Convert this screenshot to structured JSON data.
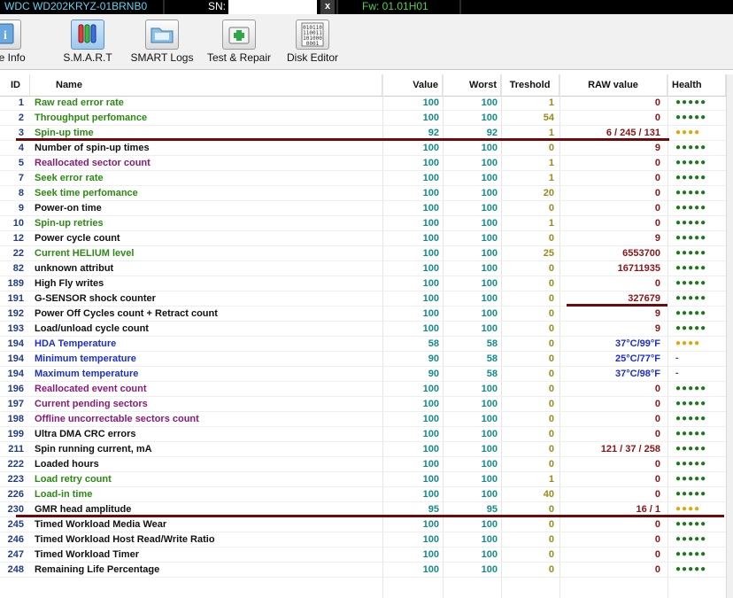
{
  "topbar": {
    "model": "WDC WD202KRYZ-01BRNB0",
    "sn_label": "SN:",
    "sn_value": "",
    "clear_label": "x",
    "firmware": "Fw: 01.01H01"
  },
  "toolbar": {
    "items": [
      {
        "label": "rive Info",
        "icon": "info-icon"
      },
      {
        "label": "S.M.A.R.T",
        "icon": "test-tubes-icon"
      },
      {
        "label": "SMART Logs",
        "icon": "folder-icon"
      },
      {
        "label": "Test & Repair",
        "icon": "first-aid-kit-icon"
      },
      {
        "label": "Disk Editor",
        "icon": "binary-data-icon"
      }
    ]
  },
  "table": {
    "headers": {
      "id": "ID",
      "name": "Name",
      "value": "Value",
      "worst": "Worst",
      "threshold": "Treshold",
      "raw": "RAW value",
      "health": "Health"
    },
    "rows": [
      {
        "id": "1",
        "name": "Raw read error rate",
        "value": "100",
        "worst": "100",
        "threshold": "1",
        "raw": "0",
        "health": "●●●●●",
        "name_color": "green",
        "health_color": "green"
      },
      {
        "id": "2",
        "name": "Throughput perfomance",
        "value": "100",
        "worst": "100",
        "threshold": "54",
        "raw": "0",
        "health": "●●●●●",
        "name_color": "green",
        "health_color": "green"
      },
      {
        "id": "3",
        "name": "Spin-up time",
        "value": "92",
        "worst": "92",
        "threshold": "1",
        "raw": "6 / 245 / 131",
        "health": "●●●●",
        "name_color": "green",
        "health_color": "yellow"
      },
      {
        "id": "4",
        "name": "Number of spin-up times",
        "value": "100",
        "worst": "100",
        "threshold": "0",
        "raw": "9",
        "health": "●●●●●",
        "name_color": "black",
        "health_color": "green"
      },
      {
        "id": "5",
        "name": "Reallocated sector count",
        "value": "100",
        "worst": "100",
        "threshold": "1",
        "raw": "0",
        "health": "●●●●●",
        "name_color": "purple",
        "health_color": "green"
      },
      {
        "id": "7",
        "name": "Seek error rate",
        "value": "100",
        "worst": "100",
        "threshold": "1",
        "raw": "0",
        "health": "●●●●●",
        "name_color": "green",
        "health_color": "green"
      },
      {
        "id": "8",
        "name": "Seek time perfomance",
        "value": "100",
        "worst": "100",
        "threshold": "20",
        "raw": "0",
        "health": "●●●●●",
        "name_color": "green",
        "health_color": "green"
      },
      {
        "id": "9",
        "name": "Power-on time",
        "value": "100",
        "worst": "100",
        "threshold": "0",
        "raw": "0",
        "health": "●●●●●",
        "name_color": "black",
        "health_color": "green"
      },
      {
        "id": "10",
        "name": "Spin-up retries",
        "value": "100",
        "worst": "100",
        "threshold": "1",
        "raw": "0",
        "health": "●●●●●",
        "name_color": "green",
        "health_color": "green"
      },
      {
        "id": "12",
        "name": "Power cycle count",
        "value": "100",
        "worst": "100",
        "threshold": "0",
        "raw": "9",
        "health": "●●●●●",
        "name_color": "black",
        "health_color": "green"
      },
      {
        "id": "22",
        "name": "Current HELIUM level",
        "value": "100",
        "worst": "100",
        "threshold": "25",
        "raw": "6553700",
        "health": "●●●●●",
        "name_color": "green",
        "health_color": "green"
      },
      {
        "id": "82",
        "name": "unknown attribut",
        "value": "100",
        "worst": "100",
        "threshold": "0",
        "raw": "16711935",
        "health": "●●●●●",
        "name_color": "black",
        "health_color": "green"
      },
      {
        "id": "189",
        "name": "High Fly writes",
        "value": "100",
        "worst": "100",
        "threshold": "0",
        "raw": "0",
        "health": "●●●●●",
        "name_color": "black",
        "health_color": "green"
      },
      {
        "id": "191",
        "name": "G-SENSOR shock counter",
        "value": "100",
        "worst": "100",
        "threshold": "0",
        "raw": "327679",
        "health": "●●●●●",
        "name_color": "black",
        "health_color": "green"
      },
      {
        "id": "192",
        "name": "Power Off Cycles count + Retract count",
        "value": "100",
        "worst": "100",
        "threshold": "0",
        "raw": "9",
        "health": "●●●●●",
        "name_color": "black",
        "health_color": "green"
      },
      {
        "id": "193",
        "name": "Load/unload cycle count",
        "value": "100",
        "worst": "100",
        "threshold": "0",
        "raw": "9",
        "health": "●●●●●",
        "name_color": "black",
        "health_color": "green"
      },
      {
        "id": "194",
        "name": "HDA Temperature",
        "value": "58",
        "worst": "58",
        "threshold": "0",
        "raw": "37°C/99°F",
        "health": "●●●●",
        "name_color": "blue",
        "health_color": "yellow",
        "raw_color": "blue"
      },
      {
        "id": "194",
        "name": "Minimum temperature",
        "value": "90",
        "worst": "58",
        "threshold": "0",
        "raw": "25°C/77°F",
        "health": "-",
        "name_color": "blue",
        "health_color": "blue",
        "raw_color": "blue"
      },
      {
        "id": "194",
        "name": "Maximum temperature",
        "value": "90",
        "worst": "58",
        "threshold": "0",
        "raw": "37°C/98°F",
        "health": "-",
        "name_color": "blue",
        "health_color": "blue",
        "raw_color": "blue"
      },
      {
        "id": "196",
        "name": "Reallocated event count",
        "value": "100",
        "worst": "100",
        "threshold": "0",
        "raw": "0",
        "health": "●●●●●",
        "name_color": "purple",
        "health_color": "green"
      },
      {
        "id": "197",
        "name": "Current pending sectors",
        "value": "100",
        "worst": "100",
        "threshold": "0",
        "raw": "0",
        "health": "●●●●●",
        "name_color": "purple",
        "health_color": "green"
      },
      {
        "id": "198",
        "name": "Offline uncorrectable sectors count",
        "value": "100",
        "worst": "100",
        "threshold": "0",
        "raw": "0",
        "health": "●●●●●",
        "name_color": "purple",
        "health_color": "green"
      },
      {
        "id": "199",
        "name": "Ultra DMA CRC errors",
        "value": "100",
        "worst": "100",
        "threshold": "0",
        "raw": "0",
        "health": "●●●●●",
        "name_color": "black",
        "health_color": "green"
      },
      {
        "id": "211",
        "name": "Spin running current, mA",
        "value": "100",
        "worst": "100",
        "threshold": "0",
        "raw": "121 / 37 / 258",
        "health": "●●●●●",
        "name_color": "black",
        "health_color": "green"
      },
      {
        "id": "222",
        "name": "Loaded hours",
        "value": "100",
        "worst": "100",
        "threshold": "0",
        "raw": "0",
        "health": "●●●●●",
        "name_color": "black",
        "health_color": "green"
      },
      {
        "id": "223",
        "name": "Load retry count",
        "value": "100",
        "worst": "100",
        "threshold": "1",
        "raw": "0",
        "health": "●●●●●",
        "name_color": "green",
        "health_color": "green"
      },
      {
        "id": "226",
        "name": "Load-in time",
        "value": "100",
        "worst": "100",
        "threshold": "40",
        "raw": "0",
        "health": "●●●●●",
        "name_color": "green",
        "health_color": "green"
      },
      {
        "id": "230",
        "name": "GMR head amplitude",
        "value": "95",
        "worst": "95",
        "threshold": "0",
        "raw": "16 / 1",
        "health": "●●●●",
        "name_color": "black",
        "health_color": "yellow"
      },
      {
        "id": "245",
        "name": "Timed Workload Media Wear",
        "value": "100",
        "worst": "100",
        "threshold": "0",
        "raw": "0",
        "health": "●●●●●",
        "name_color": "black",
        "health_color": "green"
      },
      {
        "id": "246",
        "name": "Timed Workload Host Read/Write Ratio",
        "value": "100",
        "worst": "100",
        "threshold": "0",
        "raw": "0",
        "health": "●●●●●",
        "name_color": "black",
        "health_color": "green"
      },
      {
        "id": "247",
        "name": "Timed Workload Timer",
        "value": "100",
        "worst": "100",
        "threshold": "0",
        "raw": "0",
        "health": "●●●●●",
        "name_color": "black",
        "health_color": "green"
      },
      {
        "id": "248",
        "name": "Remaining Life Percentage",
        "value": "100",
        "worst": "100",
        "threshold": "0",
        "raw": "0",
        "health": "●●●●●",
        "name_color": "black",
        "health_color": "green"
      }
    ]
  },
  "colors": {
    "model_text": "#5fd3f3",
    "firmware_text": "#4cd44c",
    "annotation_underline": "#6e0a0a"
  }
}
